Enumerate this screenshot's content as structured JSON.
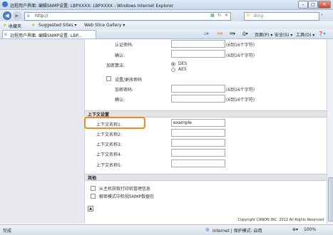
{
  "window": {
    "title": "远程用户界面: 编辑SNMP设置: LBPXXXX: LBPXXXX - Windows Internet Explorer",
    "minimize": "–",
    "maximize": "□",
    "close": "✕"
  },
  "address": {
    "url": "http://",
    "search_placeholder": "Bing"
  },
  "favorites": {
    "label": "收藏夹",
    "suggested": "Suggested Sites ▾",
    "gallery": "Web Slice Gallery ▾"
  },
  "tab": {
    "title": "远程用户界面: 编辑SNMP设置: LBP..."
  },
  "commands": {
    "page": "页面(P) ▾",
    "safety": "安全(S) ▾",
    "tools": "工具(O) ▾",
    "help": "❓▾"
  },
  "form": {
    "auth_password_label": "认证密码:",
    "confirm_label_1": "确认:",
    "hint": "(6到16个字符)",
    "encrypt_algo_label": "加密算法:",
    "des": "DES",
    "aes": "AES",
    "set_change_password": "设置/更改密码",
    "encrypt_password_label": "加密密码:",
    "confirm_label_2": "确认:",
    "context_section": "上下文设置",
    "ctx1_label": "上下文名称1:",
    "ctx1_value": "example",
    "ctx2_label": "上下文名称2:",
    "ctx3_label": "上下文名称3:",
    "ctx4_label": "上下文名称4:",
    "ctx5_label": "上下文名称5:",
    "other_section": "其他",
    "get_from_host": "从主机获取打印机管理信息",
    "specify_snmp": "解密模式中检视SNMP数据包",
    "copyright": "Copyright CANON INC. 2012 All Rights Reserved"
  },
  "status": {
    "left": "完成",
    "zone": "Internet | 保护模式: 启用",
    "zoom": "100%"
  }
}
